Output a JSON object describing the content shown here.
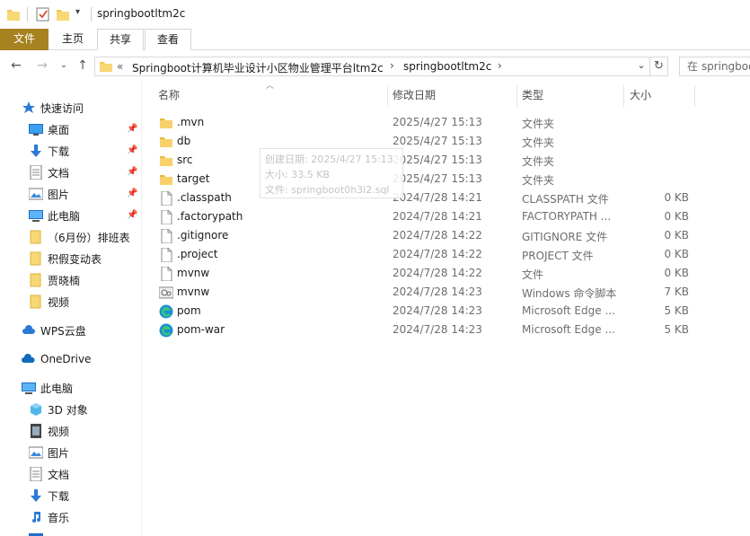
{
  "title": "springbootltm2c",
  "ribbon": {
    "tabs": [
      "文件",
      "主页",
      "共享",
      "查看"
    ]
  },
  "address": {
    "overflow": "«",
    "segments": [
      "Springboot计算机毕业设计小区物业管理平台ltm2c",
      "springbootltm2c"
    ],
    "search_placeholder": "在 springboo"
  },
  "sidebar": {
    "quick_access": "快速访问",
    "quick_items": [
      {
        "label": "桌面",
        "icon": "desktop-icon",
        "pinned": true
      },
      {
        "label": "下载",
        "icon": "download-icon",
        "pinned": true
      },
      {
        "label": "文档",
        "icon": "document-icon",
        "pinned": true
      },
      {
        "label": "图片",
        "icon": "picture-icon",
        "pinned": true
      },
      {
        "label": "此电脑",
        "icon": "computer-icon",
        "pinned": true
      },
      {
        "label": "（6月份）排班表",
        "icon": "folder-icon",
        "pinned": false
      },
      {
        "label": "积假变动表",
        "icon": "folder-icon",
        "pinned": false
      },
      {
        "label": "贾晓楠",
        "icon": "folder-icon",
        "pinned": false
      },
      {
        "label": "视频",
        "icon": "folder-icon",
        "pinned": false
      }
    ],
    "wps": "WPS云盘",
    "onedrive": "OneDrive",
    "this_pc": "此电脑",
    "pc_items": [
      {
        "label": "3D 对象",
        "icon": "3d-objects-icon"
      },
      {
        "label": "视频",
        "icon": "video-icon"
      },
      {
        "label": "图片",
        "icon": "picture-icon"
      },
      {
        "label": "文档",
        "icon": "document-icon"
      },
      {
        "label": "下载",
        "icon": "download-icon"
      },
      {
        "label": "音乐",
        "icon": "music-icon"
      }
    ]
  },
  "columns": {
    "name": "名称",
    "date": "修改日期",
    "type": "类型",
    "size": "大小"
  },
  "files": [
    {
      "name": ".mvn",
      "date": "2025/4/27 15:13",
      "type": "文件夹",
      "size": "",
      "icon": "folder-icon"
    },
    {
      "name": "db",
      "date": "2025/4/27 15:13",
      "type": "文件夹",
      "size": "",
      "icon": "folder-icon"
    },
    {
      "name": "src",
      "date": "2025/4/27 15:13",
      "type": "文件夹",
      "size": "",
      "icon": "folder-icon"
    },
    {
      "name": "target",
      "date": "2025/4/27 15:13",
      "type": "文件夹",
      "size": "",
      "icon": "folder-icon"
    },
    {
      "name": ".classpath",
      "date": "2024/7/28 14:21",
      "type": "CLASSPATH 文件",
      "size": "0 KB",
      "icon": "file-icon"
    },
    {
      "name": ".factorypath",
      "date": "2024/7/28 14:21",
      "type": "FACTORYPATH ...",
      "size": "0 KB",
      "icon": "file-icon"
    },
    {
      "name": ".gitignore",
      "date": "2024/7/28 14:22",
      "type": "GITIGNORE 文件",
      "size": "0 KB",
      "icon": "file-icon"
    },
    {
      "name": ".project",
      "date": "2024/7/28 14:22",
      "type": "PROJECT 文件",
      "size": "0 KB",
      "icon": "file-icon"
    },
    {
      "name": "mvnw",
      "date": "2024/7/28 14:22",
      "type": "文件",
      "size": "0 KB",
      "icon": "file-icon"
    },
    {
      "name": "mvnw",
      "date": "2024/7/28 14:23",
      "type": "Windows 命令脚本",
      "size": "7 KB",
      "icon": "script-icon"
    },
    {
      "name": "pom",
      "date": "2024/7/28 14:23",
      "type": "Microsoft Edge ...",
      "size": "5 KB",
      "icon": "edge-icon"
    },
    {
      "name": "pom-war",
      "date": "2024/7/28 14:23",
      "type": "Microsoft Edge ...",
      "size": "5 KB",
      "icon": "edge-icon"
    }
  ],
  "tooltip": {
    "line1": "创建日期: 2025/4/27 15:13",
    "line2": "大小: 33.5 KB",
    "line3": "文件: springboot0h3l2.sql"
  },
  "colors": {
    "file_tab": "#a78221",
    "folder": "#f5c74d",
    "accent": "#0078d7"
  }
}
